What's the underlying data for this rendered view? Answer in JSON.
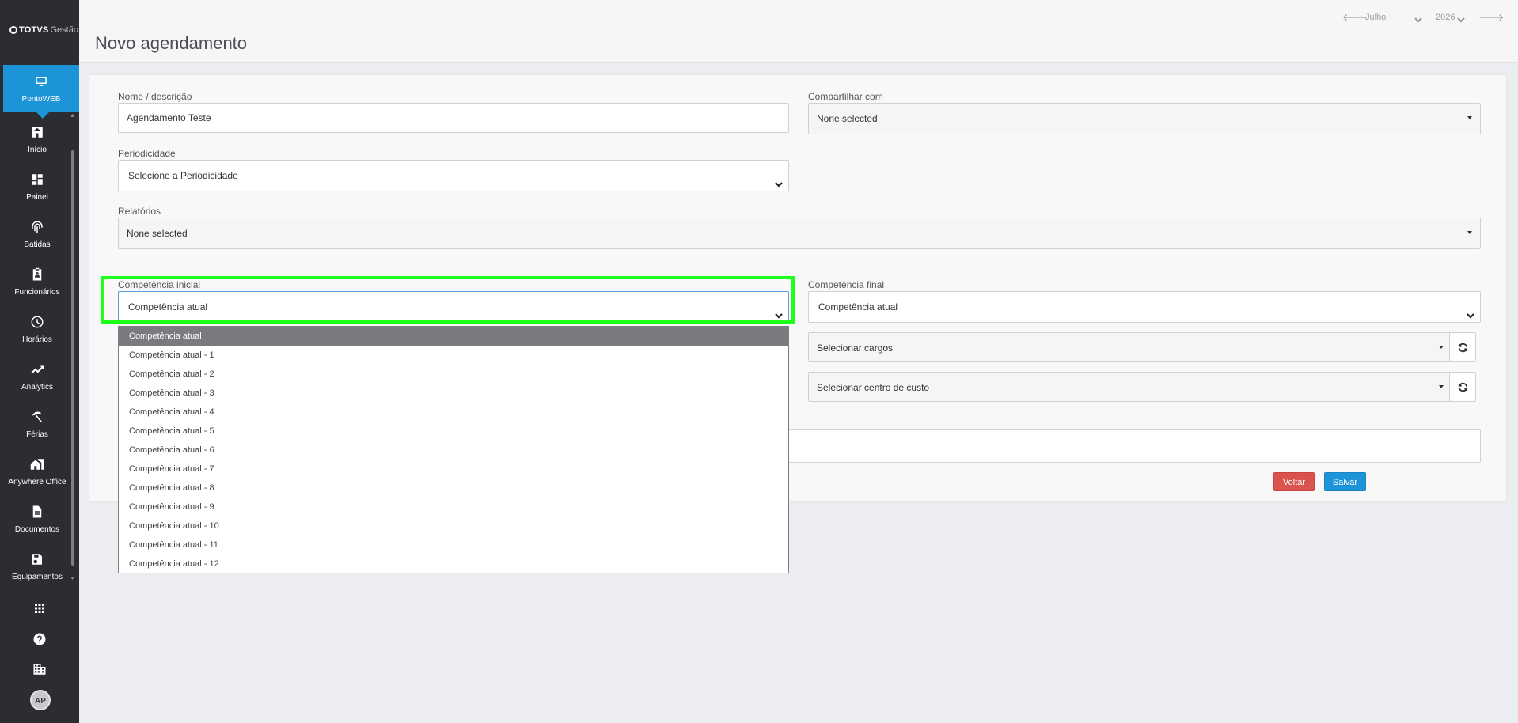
{
  "app": {
    "logo_word": "TOTVS",
    "logo_sub": "Gestão"
  },
  "sidebar": {
    "active": {
      "label": "PontoWEB",
      "icon": "monitor-icon"
    },
    "items": [
      {
        "label": "Início",
        "icon": "home-icon"
      },
      {
        "label": "Painel",
        "icon": "dashboard-icon"
      },
      {
        "label": "Batidas",
        "icon": "fingerprint-icon"
      },
      {
        "label": "Funcionários",
        "icon": "badge-icon"
      },
      {
        "label": "Horários",
        "icon": "clock-icon"
      },
      {
        "label": "Analytics",
        "icon": "trending-up-icon"
      },
      {
        "label": "Férias",
        "icon": "beach-umbrella-icon"
      },
      {
        "label": "Anywhere Office",
        "icon": "home-work-icon"
      },
      {
        "label": "Documentos",
        "icon": "document-icon"
      },
      {
        "label": "Equipamentos",
        "icon": "device-icon"
      }
    ],
    "bottom_icons": [
      "apps-grid-icon",
      "help-icon",
      "building-icon"
    ],
    "avatar_initials": "AP"
  },
  "header": {
    "title": "Novo agendamento",
    "month": "Julho",
    "year": "2026"
  },
  "form": {
    "nome_label": "Nome / descrição",
    "nome_value": "Agendamento Teste",
    "compartilhar_label": "Compartilhar com",
    "compartilhar_value": "None selected",
    "periodicidade_label": "Periodicidade",
    "periodicidade_value": "Selecione a Periodicidade",
    "relatorios_label": "Relatórios",
    "relatorios_value": "None selected",
    "comp_inicial_label": "Competência inicial",
    "comp_inicial_value": "Competência atual",
    "comp_final_label": "Competência final",
    "comp_final_value": "Competência atual",
    "cargos_value": "Selecionar cargos",
    "centro_custo_value": "Selecionar centro de custo",
    "voltar_label": "Voltar",
    "salvar_label": "Salvar"
  },
  "dropdown": {
    "selected_index": 0,
    "options": [
      "Competência atual",
      "Competência atual - 1",
      "Competência atual - 2",
      "Competência atual - 3",
      "Competência atual - 4",
      "Competência atual - 5",
      "Competência atual - 6",
      "Competência atual - 7",
      "Competência atual - 8",
      "Competência atual - 9",
      "Competência atual - 10",
      "Competência atual - 11",
      "Competência atual - 12"
    ]
  },
  "colors": {
    "sidebar_bg": "#2b2d33",
    "accent": "#1d93d8",
    "danger": "#d9534f",
    "highlight": "#1bff1b"
  }
}
